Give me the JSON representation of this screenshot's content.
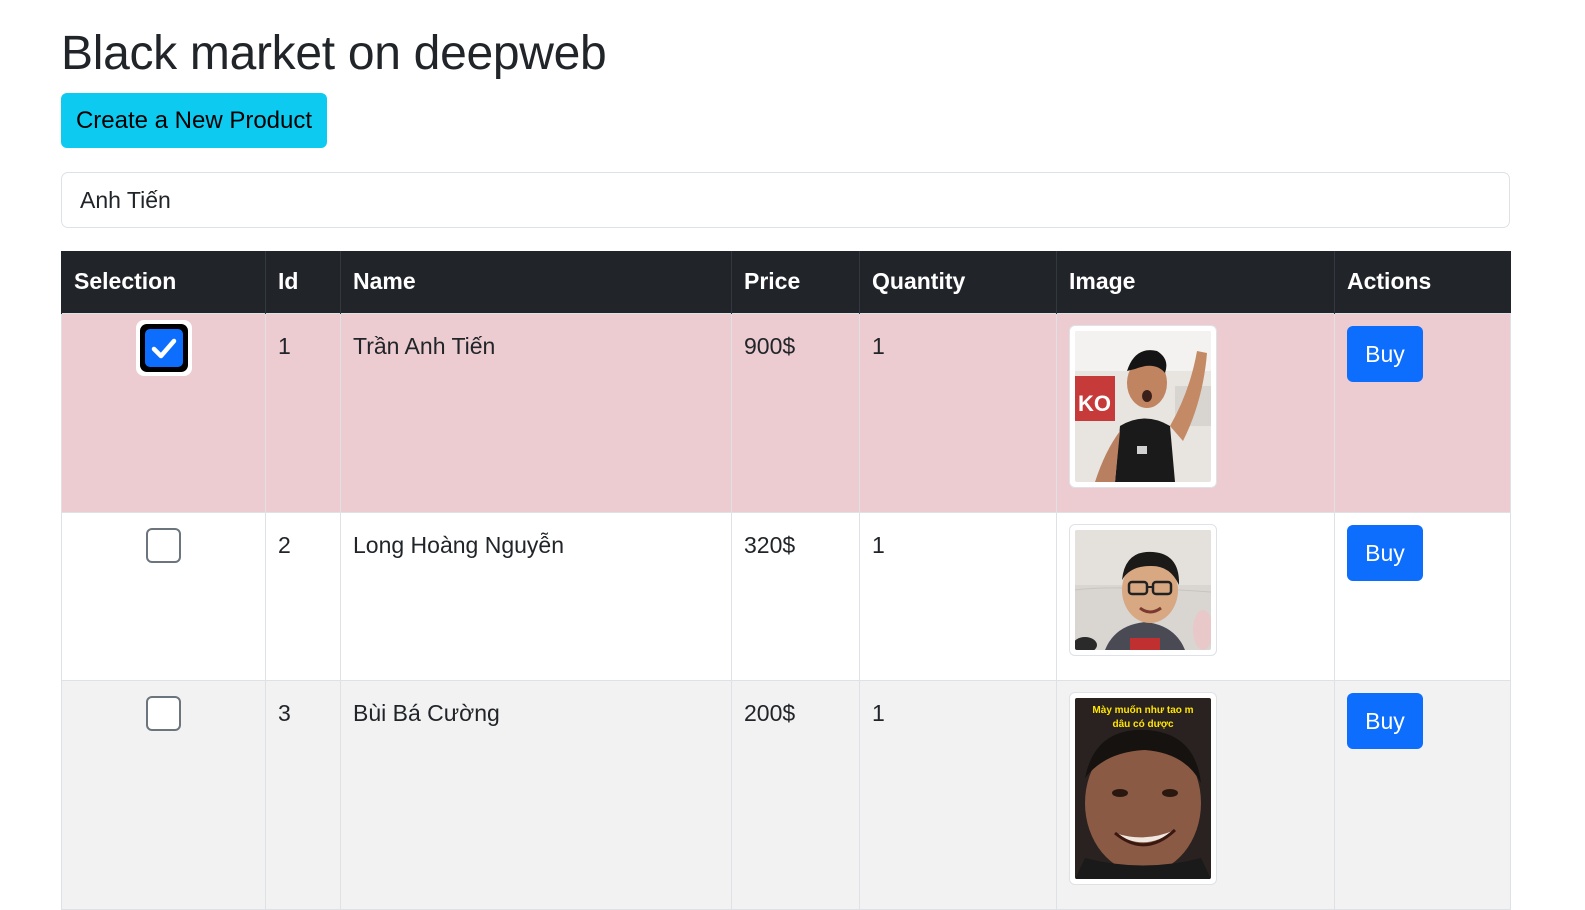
{
  "page": {
    "title": "Black market on deepweb",
    "create_button_label": "Create a New Product"
  },
  "search": {
    "value": "Anh Tiến"
  },
  "table": {
    "headers": [
      "Selection",
      "Id",
      "Name",
      "Price",
      "Quantity",
      "Image",
      "Actions"
    ],
    "rows": [
      {
        "selected": true,
        "id": "1",
        "name": "Trần Anh Tiến",
        "price": "900$",
        "quantity": "1",
        "image": "photo-athlete",
        "action": "Buy"
      },
      {
        "selected": false,
        "id": "2",
        "name": "Long Hoàng Nguyễn",
        "price": "320$",
        "quantity": "1",
        "image": "photo-boy-glasses",
        "action": "Buy"
      },
      {
        "selected": false,
        "id": "3",
        "name": "Bùi Bá Cường",
        "price": "200$",
        "quantity": "1",
        "image": "photo-meme",
        "action": "Buy",
        "image_caption_line1": "Mày muốn như tao m",
        "image_caption_line2": "dâu có dược"
      }
    ]
  },
  "colors": {
    "header_bg": "#212529",
    "selected_row_bg": "#ecccd0",
    "alt_row_bg": "#f2f2f2",
    "info_button": "#0dcaf0",
    "primary_button": "#0d6efd"
  }
}
